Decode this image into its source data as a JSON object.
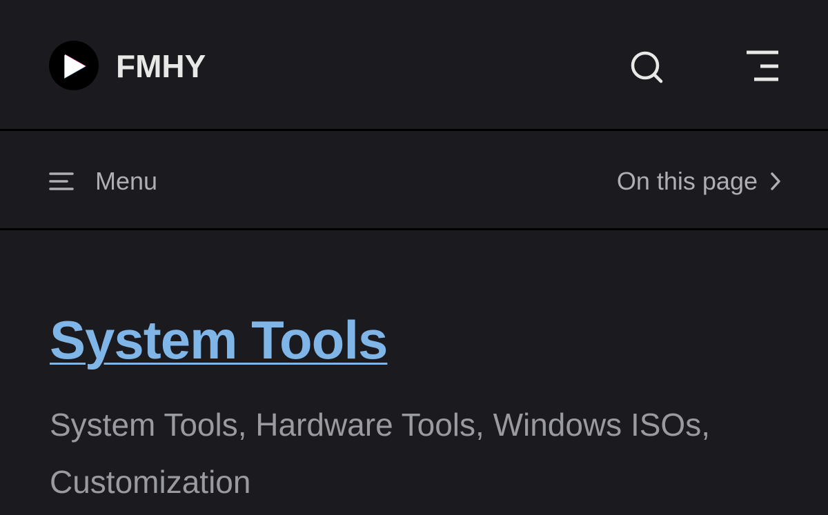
{
  "header": {
    "site_title": "FMHY",
    "logo_icon": "play-logo-icon",
    "search_icon": "search-icon",
    "nav_icon": "menu-lines-icon"
  },
  "local_nav": {
    "menu_label": "Menu",
    "menu_icon": "hamburger-icon",
    "outline_label": "On this page",
    "outline_icon": "chevron-right-icon"
  },
  "content": {
    "title": "System Tools",
    "description": "System Tools, Hardware Tools, Windows ISOs, Customization"
  },
  "colors": {
    "background": "#1b1b1f",
    "title_link": "#7fb6e7",
    "text_muted": "#aeaeb4",
    "divider": "#000000"
  }
}
